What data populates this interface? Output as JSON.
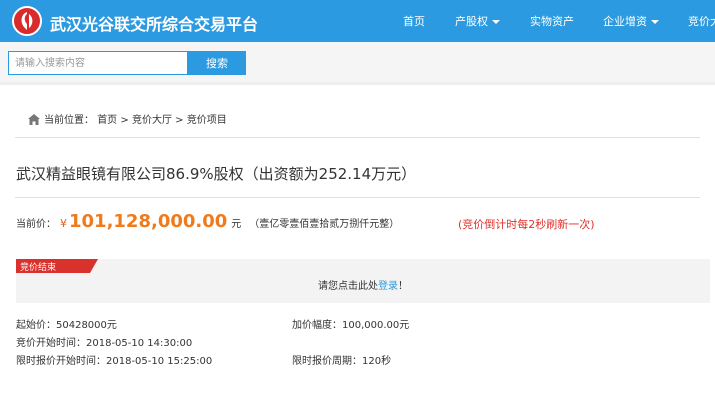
{
  "header": {
    "site_title": "武汉光谷联交所综合交易平台",
    "nav": [
      {
        "label": "首页",
        "dropdown": false
      },
      {
        "label": "产股权",
        "dropdown": true
      },
      {
        "label": "实物资产",
        "dropdown": false
      },
      {
        "label": "企业增资",
        "dropdown": true
      },
      {
        "label": "竞价大",
        "dropdown": false
      }
    ]
  },
  "search": {
    "placeholder": "请输入搜索内容",
    "button_label": "搜索"
  },
  "breadcrumb": {
    "prefix": "当前位置：",
    "items": [
      "首页",
      "竞价大厅",
      "竞价项目"
    ],
    "separator": ">"
  },
  "project": {
    "title": "武汉精益眼镜有限公司86.9%股权（出资额为252.14万元）"
  },
  "price": {
    "label": "当前价：",
    "currency": "¥",
    "value": "101,128,000.00",
    "unit": "元",
    "chinese": "（壹亿零壹佰壹拾贰万捌仟元整）",
    "refresh_note": "(竞价倒计时每2秒刷新一次)"
  },
  "status": {
    "tag": "竞价结束",
    "login_prefix": "请您点击此处",
    "login_link": "登录",
    "login_suffix": "！"
  },
  "details": {
    "start_price": "起始价：50428000元",
    "increment": "加价幅度：100,000.00元",
    "start_time": "竞价开始时间：2018-05-10 14:30:00",
    "limit_start_time": "限时报价开始时间：2018-05-10 15:25:00",
    "limit_period": "限时报价周期：120秒"
  },
  "colors": {
    "brand_blue": "#2b9ae0",
    "price_orange": "#f07b1c",
    "alert_red": "#e0312b",
    "logo_red": "#d92b2b"
  }
}
